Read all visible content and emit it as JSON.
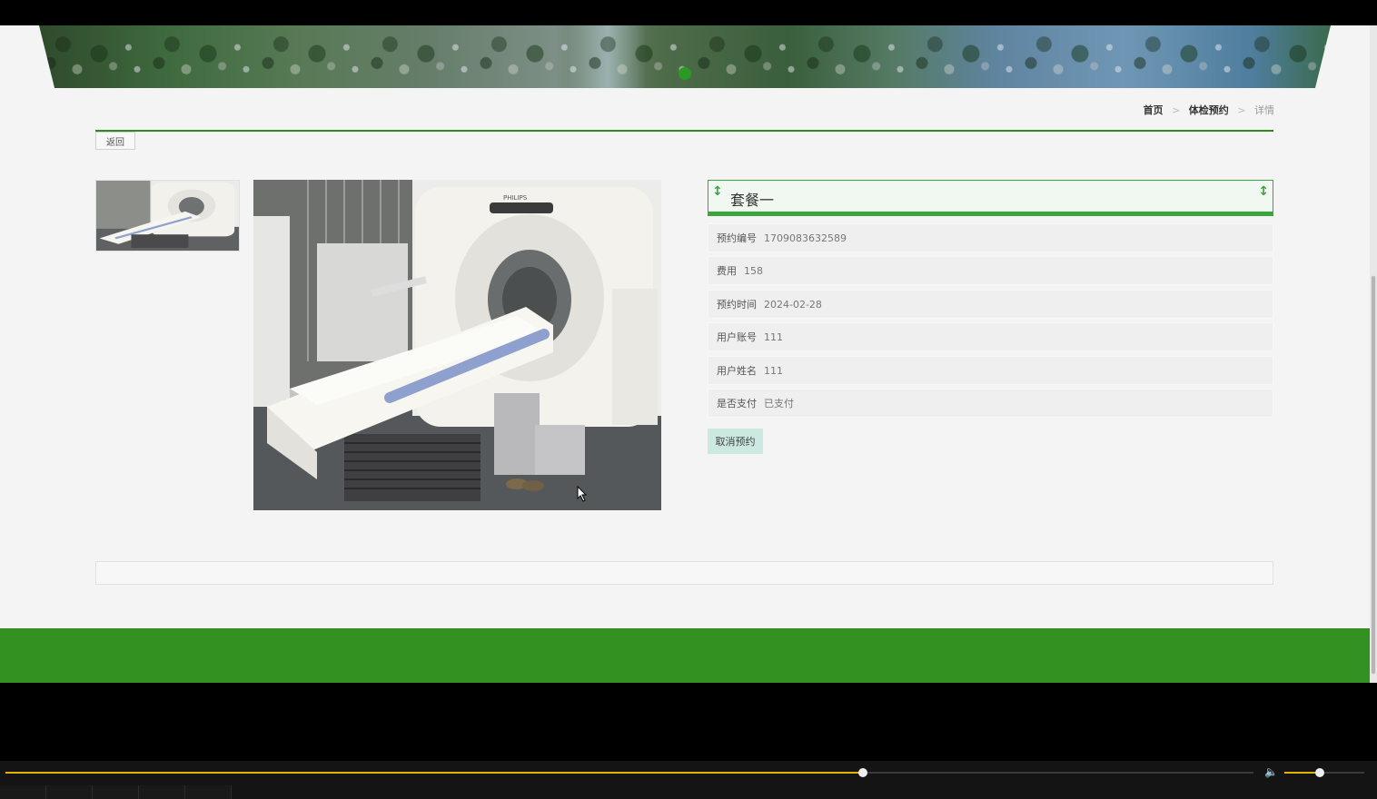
{
  "breadcrumb": {
    "home": "首页",
    "section": "体检预约",
    "current": "详情",
    "separator": ">"
  },
  "back_label": "返回",
  "detail": {
    "title": "套餐一",
    "fields": [
      {
        "label": "预约编号",
        "value": "1709083632589"
      },
      {
        "label": "费用",
        "value": "158"
      },
      {
        "label": "预约时间",
        "value": "2024-02-28"
      },
      {
        "label": "用户账号",
        "value": "111"
      },
      {
        "label": "用户姓名",
        "value": "111"
      },
      {
        "label": "是否支付",
        "value": "已支付"
      }
    ],
    "cancel_label": "取消预约"
  },
  "image_brand": "PHILIPS",
  "player": {
    "seek_progress": 0.687,
    "volume_level": 0.44
  },
  "colors": {
    "accent": "#339122",
    "title_border": "#3aa53a",
    "cancel_bg": "#cbe8e1",
    "seek_fill": "#e0b400"
  }
}
